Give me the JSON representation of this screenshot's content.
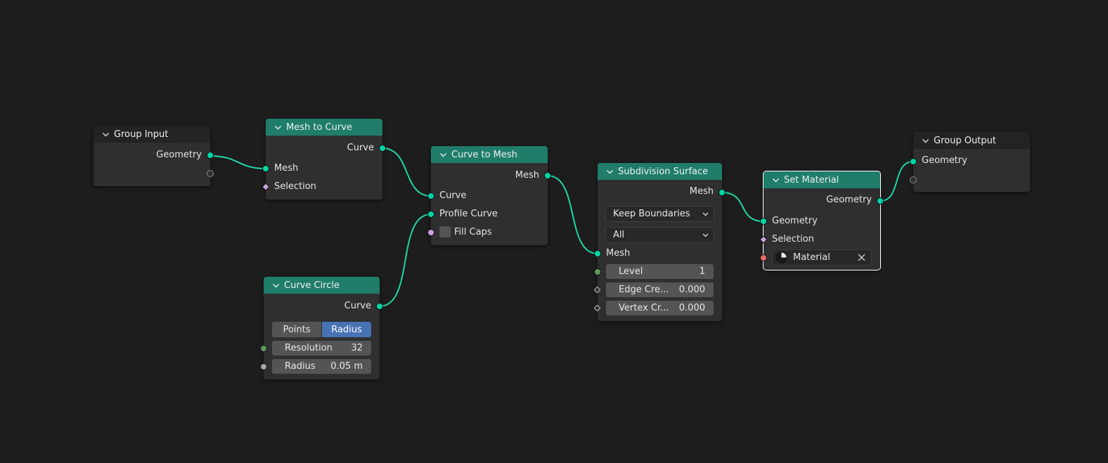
{
  "links_color": "#1fd6a5",
  "group_input": {
    "title": "Group Input",
    "outputs": [
      "Geometry"
    ]
  },
  "mesh_to_curve": {
    "title": "Mesh to Curve",
    "output": "Curve",
    "inputs": [
      "Mesh",
      "Selection"
    ]
  },
  "curve_to_mesh": {
    "title": "Curve to Mesh",
    "output": "Mesh",
    "inputs": [
      "Curve",
      "Profile Curve"
    ],
    "fill_caps": "Fill Caps"
  },
  "curve_circle": {
    "title": "Curve Circle",
    "output": "Curve",
    "mode_options": [
      "Points",
      "Radius"
    ],
    "mode_selected": "Radius",
    "resolution_label": "Resolution",
    "resolution_value": "32",
    "radius_label": "Radius",
    "radius_value": "0.05 m"
  },
  "subdivision_surface": {
    "title": "Subdivision Surface",
    "output": "Mesh",
    "boundary_mode": "Keep Boundaries",
    "uv_smooth": "All",
    "mesh_input": "Mesh",
    "level_label": "Level",
    "level_value": "1",
    "edge_crease_label": "Edge Cre...",
    "edge_crease_value": "0.000",
    "vertex_crease_label": "Vertex Cr...",
    "vertex_crease_value": "0.000"
  },
  "set_material": {
    "title": "Set Material",
    "output": "Geometry",
    "inputs": [
      "Geometry",
      "Selection"
    ],
    "material": "Material"
  },
  "group_output": {
    "title": "Group Output",
    "inputs": [
      "Geometry"
    ]
  }
}
